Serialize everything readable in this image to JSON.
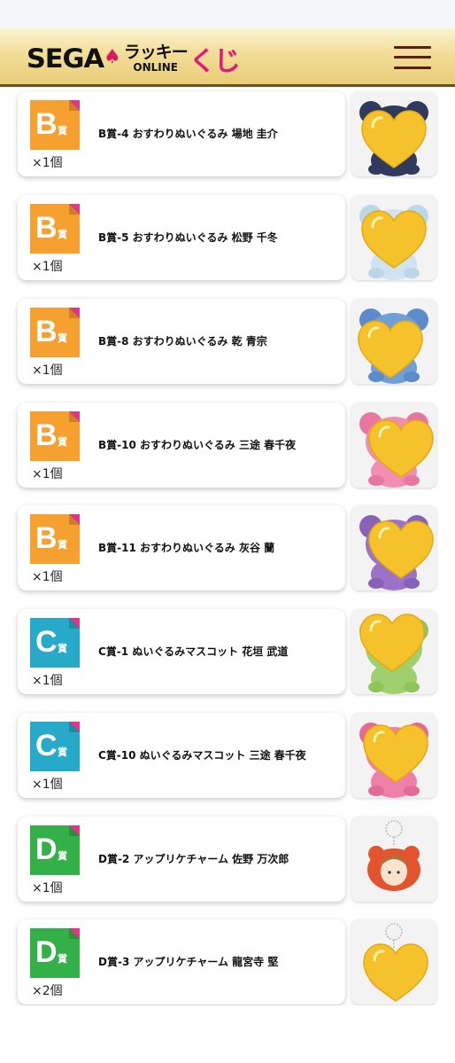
{
  "header": {
    "logo_brand": "SEGA",
    "logo_lucky": "ラッキー",
    "logo_online": "ONLINE",
    "logo_kuji": "くじ",
    "menu_icon": "hamburger-menu-icon"
  },
  "colors": {
    "B": "#f6a02f",
    "C": "#27a9c9",
    "D": "#33b048",
    "badge_corner": "#e5338c"
  },
  "badge_suffix": "賞",
  "items": [
    {
      "grade": "B",
      "name": "B賞-4 おすわりぬいぐるみ 場地 圭介",
      "qty": "×1個",
      "thumb": "plush-navy-bear"
    },
    {
      "grade": "B",
      "name": "B賞-5 おすわりぬいぐるみ 松野 千冬",
      "qty": "×1個",
      "thumb": "plush-light-blue-bear"
    },
    {
      "grade": "B",
      "name": "B賞-8 おすわりぬいぐるみ 乾 青宗",
      "qty": "×1個",
      "thumb": "plush-blue-bear"
    },
    {
      "grade": "B",
      "name": "B賞-10 おすわりぬいぐるみ 三途 春千夜",
      "qty": "×1個",
      "thumb": "plush-pink-bear"
    },
    {
      "grade": "B",
      "name": "B賞-11 おすわりぬいぐるみ 灰谷 蘭",
      "qty": "×1個",
      "thumb": "plush-purple-bear"
    },
    {
      "grade": "C",
      "name": "C賞-1 ぬいぐるみマスコット 花垣 武道",
      "qty": "×1個",
      "thumb": "mascot-green-bear"
    },
    {
      "grade": "C",
      "name": "C賞-10 ぬいぐるみマスコット 三途 春千夜",
      "qty": "×1個",
      "thumb": "mascot-pink-bear"
    },
    {
      "grade": "D",
      "name": "D賞-2 アップリケチャーム 佐野 万次郎",
      "qty": "×1個",
      "thumb": "charm-orange-bear"
    },
    {
      "grade": "D",
      "name": "D賞-3 アップリケチャーム 龍宮寺 堅",
      "qty": "×2個",
      "thumb": "charm-pink-bear"
    }
  ]
}
